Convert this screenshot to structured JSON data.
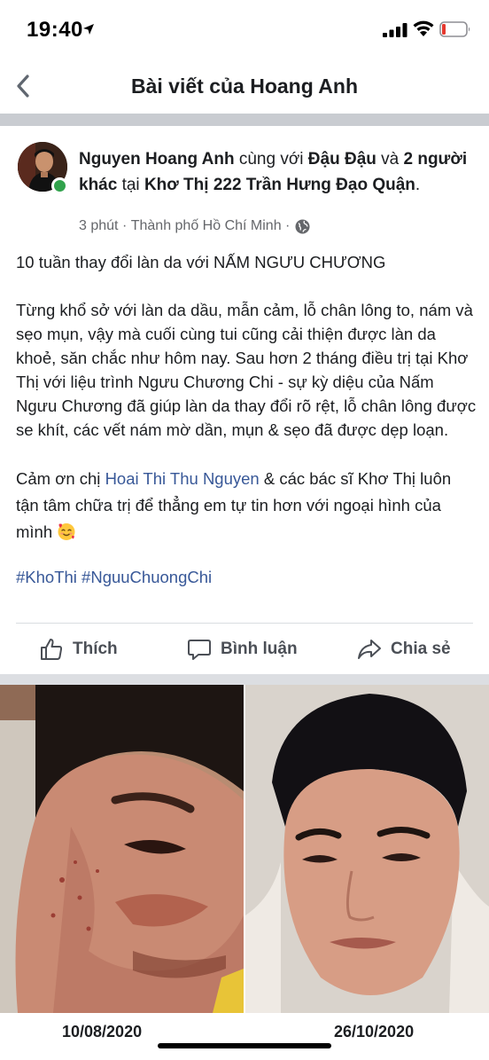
{
  "status_bar": {
    "time": "19:40",
    "icons": [
      "location-arrow-icon",
      "cellular-signal-icon",
      "wifi-icon",
      "battery-icon"
    ]
  },
  "nav": {
    "title": "Bài viết của Hoang Anh",
    "back_icon": "chevron-left-icon"
  },
  "post": {
    "author": "Nguyen Hoang Anh",
    "with_text": " cùng với ",
    "tagged": "Đậu Đậu",
    "and_text": " và ",
    "others": "2 người khác",
    "at_text": " tại ",
    "place": "Khơ Thị 222 Trần Hưng Đạo Quận",
    "end_dot": ".",
    "time": "3 phút",
    "location": "Thành phố Hồ Chí Minh",
    "sep": "·",
    "privacy_icon": "globe-icon",
    "headline": "10 tuần thay đổi làn da với NẤM NGƯU CHƯƠNG",
    "story": "Từng khổ sở với làn da dầu, mẫn cảm, lỗ chân lông to, nám và sẹo mụn, vậy mà cuối cùng tui cũng cải thiện được làn da khoẻ, săn chắc như hôm nay. Sau hơn 2 tháng điều trị tại Khơ Thị với liệu trình Ngưu Chương Chi - sự kỳ diệu của Nấm Ngưu Chương đã giúp làn da thay đổi rõ rệt, lỗ chân lông được se khít, các vết nám mờ dần, mụn & sẹo đã được dẹp loạn.",
    "thanks_prefix": "Cảm ơn chị ",
    "thanks_link": "Hoai Thi Thu Nguyen",
    "thanks_suffix": " & các bác sĩ Khơ Thị luôn tận tâm chữa trị để thẳng em tự tin hơn với ngoại hình của mình ",
    "emoji": "smiling-face-with-hearts-icon",
    "hashtags": "#KhoThi #NguuChuongChi"
  },
  "actions": {
    "like": "Thích",
    "comment": "Bình luận",
    "share": "Chia sẻ"
  },
  "photos": {
    "before_date": "10/08/2020",
    "after_date": "26/10/2020"
  },
  "colors": {
    "link": "#385898",
    "online": "#31a24c",
    "meta": "#65676b",
    "divider": "#c9ccd1"
  }
}
